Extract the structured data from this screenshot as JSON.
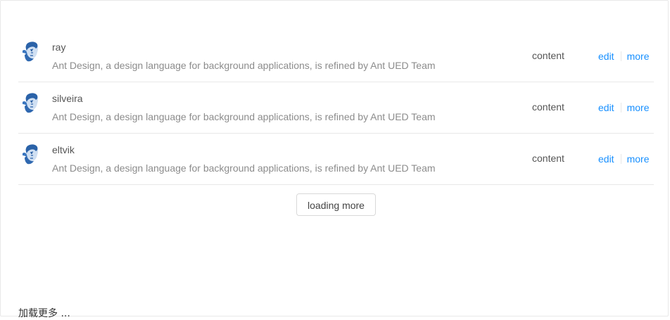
{
  "list": {
    "items": [
      {
        "name": "ray",
        "description": "Ant Design, a design language for background applications, is refined by Ant UED Team",
        "content": "content",
        "edit_label": "edit",
        "more_label": "more",
        "avatar_icon": "user-avatar-icon"
      },
      {
        "name": "silveira",
        "description": "Ant Design, a design language for background applications, is refined by Ant UED Team",
        "content": "content",
        "edit_label": "edit",
        "more_label": "more",
        "avatar_icon": "user-avatar-icon"
      },
      {
        "name": "eltvik",
        "description": "Ant Design, a design language for background applications, is refined by Ant UED Team",
        "content": "content",
        "edit_label": "edit",
        "more_label": "more",
        "avatar_icon": "user-avatar-icon"
      }
    ],
    "load_more_label": "loading more"
  },
  "footer": {
    "note": "加载更多 ..."
  },
  "colors": {
    "link": "#1890ff",
    "border": "#e8e8e8",
    "text": "#555555",
    "secondary_text": "#8c8c8c"
  }
}
